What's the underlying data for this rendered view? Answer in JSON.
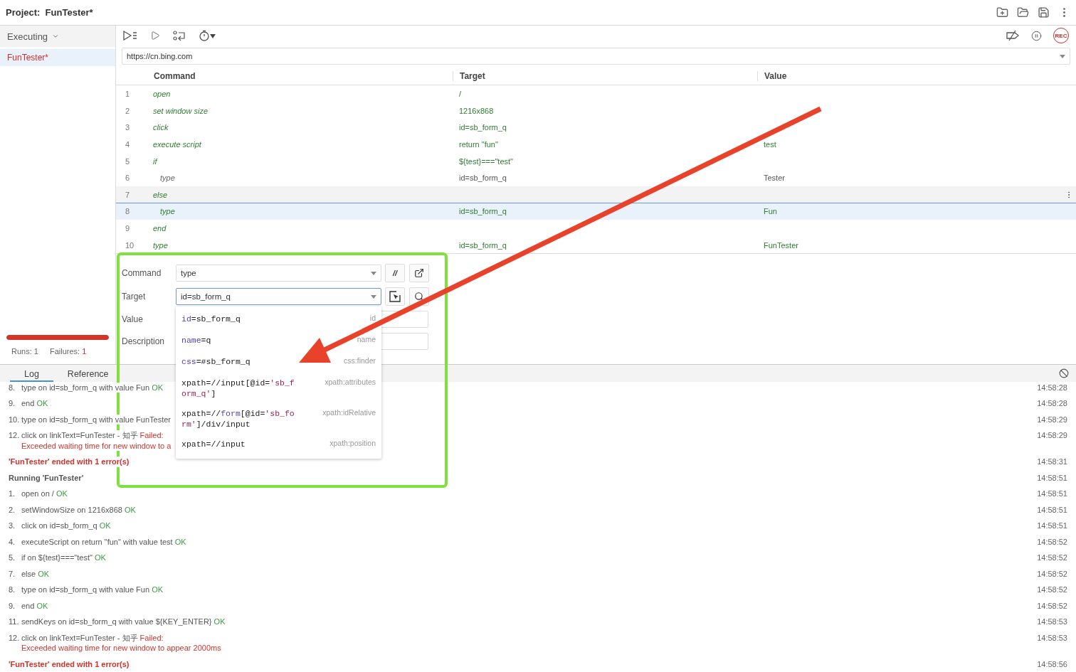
{
  "header": {
    "title": "Project:  FunTester*"
  },
  "sidebar": {
    "dropdown": "Executing",
    "tests": [
      {
        "name": "FunTester*",
        "selected": true,
        "failed": true
      }
    ],
    "progress": {
      "level": 1,
      "failed": true
    },
    "runs_label": "Runs:",
    "runs": "1",
    "failures_label": "Failures:",
    "failures": "1"
  },
  "toolbar": {
    "rec": "REC"
  },
  "url": "https://cn.bing.com",
  "table": {
    "columns": [
      "Command",
      "Target",
      "Value"
    ],
    "rows": [
      {
        "number": "1",
        "command": "open",
        "target": "/",
        "executed": true,
        "selected": false,
        "hovered": false
      },
      {
        "number": "2",
        "command": "set window size",
        "target": "1216x868",
        "executed": true,
        "selected": false,
        "hovered": false
      },
      {
        "number": "3",
        "command": "click",
        "target": "id=sb_form_q",
        "executed": true,
        "selected": false,
        "hovered": false
      },
      {
        "number": "4",
        "command": "execute script",
        "target": "return \"fun\"",
        "value": "test",
        "executed": true,
        "selected": false,
        "hovered": false
      },
      {
        "number": "5",
        "command": "if",
        "target": "${test}===\"test\"",
        "executed": true,
        "selected": false,
        "hovered": false,
        "children": [
          {
            "number": "6",
            "command": "type",
            "target": "id=sb_form_q",
            "value": "Tester",
            "executed": false,
            "selected": false,
            "hovered": false
          }
        ]
      },
      {
        "number": "7",
        "command": "else",
        "executed": true,
        "selected": false,
        "hovered": true,
        "children": [
          {
            "number": "8",
            "command": "type",
            "target": "id=sb_form_q",
            "value": "Fun",
            "executed": true,
            "selected": true,
            "hovered": false
          }
        ]
      },
      {
        "number": "9",
        "command": "end",
        "executed": true,
        "selected": false,
        "hovered": false
      },
      {
        "number": "10",
        "command": "type",
        "target": "id=sb_form_q",
        "value": "FunTester",
        "executed": true,
        "selected": false,
        "hovered": false
      }
    ]
  },
  "editor": {
    "command_label": "Command",
    "command": "type",
    "comment_button": "//",
    "target_label": "Target",
    "target": "id=sb_form_q",
    "value_label": "Value",
    "description_label": "Description",
    "suggestions": [
      {
        "parts": [
          {
            "kind": "keyword",
            "text": "id"
          },
          {
            "kind": "plain",
            "text": "=sb_form_q"
          }
        ],
        "strategy": "id"
      },
      {
        "parts": [
          {
            "kind": "keyword",
            "text": "name"
          },
          {
            "kind": "plain",
            "text": "=q"
          }
        ],
        "strategy": "name"
      },
      {
        "parts": [
          {
            "kind": "keyword",
            "text": "css"
          },
          {
            "kind": "plain",
            "text": "=#sb_form_q"
          }
        ],
        "strategy": "css:finder"
      },
      {
        "parts": [
          {
            "kind": "plain",
            "text": "xpath=//input[@id="
          },
          {
            "kind": "string",
            "text": "'sb_form_q'"
          },
          {
            "kind": "plain",
            "text": "]"
          }
        ],
        "strategy": "xpath:attributes"
      },
      {
        "parts": [
          {
            "kind": "plain",
            "text": "xpath=//"
          },
          {
            "kind": "keyword",
            "text": "form"
          },
          {
            "kind": "plain",
            "text": "[@id="
          },
          {
            "kind": "string",
            "text": "'sb_form'"
          },
          {
            "kind": "plain",
            "text": "]/div/input"
          }
        ],
        "strategy": "xpath:idRelative"
      },
      {
        "parts": [
          {
            "kind": "plain",
            "text": "xpath=//input"
          }
        ],
        "strategy": "xpath:position"
      }
    ]
  },
  "log": {
    "tabs": [
      {
        "label": "Log",
        "selected": true
      },
      {
        "label": "Reference",
        "selected": false
      }
    ],
    "entries": [
      {
        "kind": "step",
        "number": "8.",
        "text": "type on id=sb_form_q with value Fun",
        "status": "OK",
        "failed": false,
        "time": "14:58:28"
      },
      {
        "kind": "step",
        "number": "9.",
        "text": "end",
        "status": "OK",
        "failed": false,
        "time": "14:58:28"
      },
      {
        "kind": "step",
        "number": "10.",
        "text": "type on id=sb_form_q with value FunTester",
        "time": "14:58:29"
      },
      {
        "kind": "step",
        "number": "12.",
        "text": "click on linkText=FunTester - 知乎",
        "status": "Failed:",
        "failed": true,
        "error": "Exceeded waiting time for new window to a",
        "time": "14:58:29"
      },
      {
        "kind": "summary",
        "text": "'FunTester' ended with 1 error(s)",
        "time": "14:58:31"
      },
      {
        "kind": "heading",
        "text": "Running 'FunTester'",
        "time": "14:58:51"
      },
      {
        "kind": "step",
        "number": "1.",
        "text": "open on /",
        "status": "OK",
        "failed": false,
        "time": "14:58:51"
      },
      {
        "kind": "step",
        "number": "2.",
        "text": "setWindowSize on 1216x868",
        "status": "OK",
        "failed": false,
        "time": "14:58:51"
      },
      {
        "kind": "step",
        "number": "3.",
        "text": "click on id=sb_form_q",
        "status": "OK",
        "failed": false,
        "time": "14:58:51"
      },
      {
        "kind": "step",
        "number": "4.",
        "text": "executeScript on return \"fun\" with value test",
        "status": "OK",
        "failed": false,
        "time": "14:58:52"
      },
      {
        "kind": "step",
        "number": "5.",
        "text": "if on ${test}===\"test\"",
        "status": "OK",
        "failed": false,
        "time": "14:58:52"
      },
      {
        "kind": "step",
        "number": "7.",
        "text": "else",
        "status": "OK",
        "failed": false,
        "time": "14:58:52"
      },
      {
        "kind": "step",
        "number": "8.",
        "text": "type on id=sb_form_q with value Fun",
        "status": "OK",
        "failed": false,
        "time": "14:58:52"
      },
      {
        "kind": "step",
        "number": "9.",
        "text": "end",
        "status": "OK",
        "failed": false,
        "time": "14:58:52"
      },
      {
        "kind": "step",
        "number": "11.",
        "text": "sendKeys on id=sb_form_q with value ${KEY_ENTER}",
        "status": "OK",
        "failed": false,
        "time": "14:58:53"
      },
      {
        "kind": "step",
        "number": "12.",
        "text": "click on linkText=FunTester - 知乎",
        "status": "Failed:",
        "failed": true,
        "error": "Exceeded waiting time for new window to appear 2000ms",
        "time": "14:58:53"
      },
      {
        "kind": "summary",
        "text": "'FunTester' ended with 1 error(s)",
        "time": "14:58:56"
      }
    ]
  },
  "annotations": [
    {
      "kind": "rectangle",
      "color": "#7fe03e"
    },
    {
      "kind": "arrow",
      "color": "#e8432a"
    }
  ]
}
